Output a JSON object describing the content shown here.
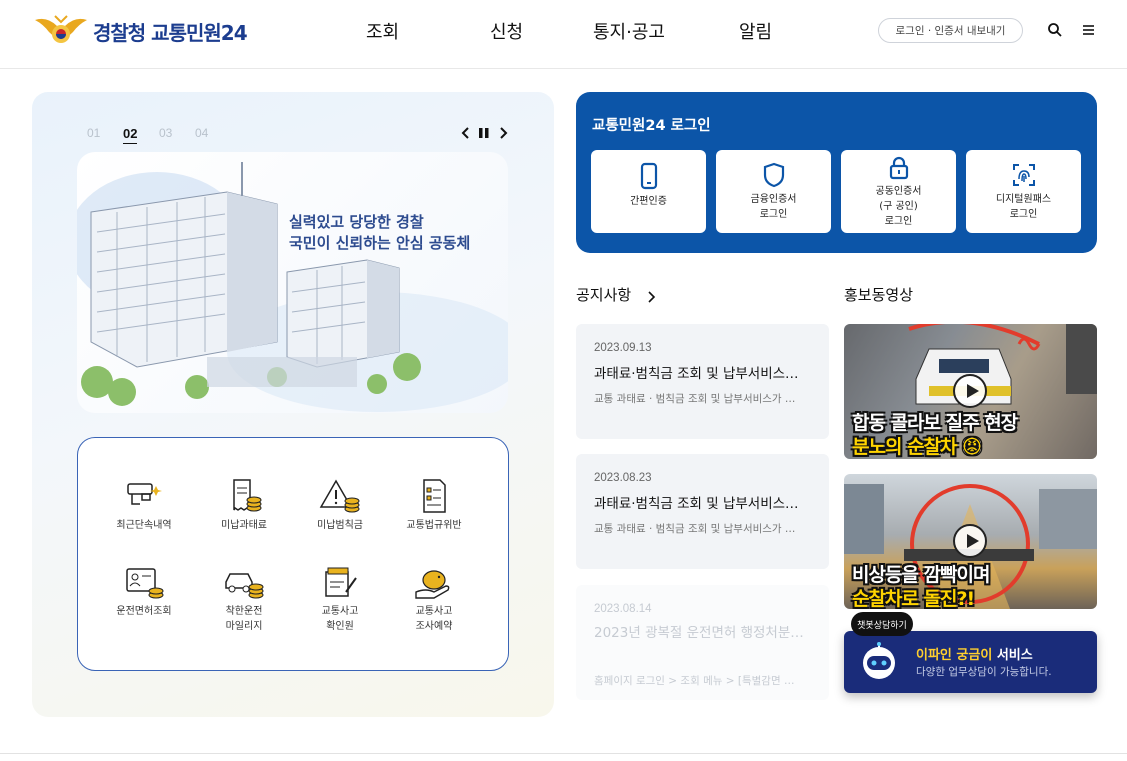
{
  "header": {
    "logo_part1": "경찰청",
    "logo_part2": "교통민원24",
    "nav": [
      "조회",
      "신청",
      "통지·공고",
      "알림"
    ],
    "cert_button": "로그인 · 인증서 내보내기"
  },
  "slider": {
    "numbers": [
      "01",
      "02",
      "03",
      "04"
    ],
    "active_index": 1,
    "banner_line1": "실력있고 당당한 경찰",
    "banner_line2": "국민이 신뢰하는 안심 공동체"
  },
  "services": [
    {
      "label": "최근단속내역",
      "icon": "camera-icon"
    },
    {
      "label": "미납과태료",
      "icon": "receipt-coins-icon"
    },
    {
      "label": "미납범칙금",
      "icon": "warning-coins-icon"
    },
    {
      "label": "교통법규위반",
      "icon": "document-check-icon"
    },
    {
      "label": "운전면허조회",
      "icon": "license-card-icon"
    },
    {
      "label_line1": "착한운전",
      "label_line2": "마일리지",
      "icon": "car-coins-icon"
    },
    {
      "label_line1": "교통사고",
      "label_line2": "확인원",
      "icon": "certificate-icon"
    },
    {
      "label_line1": "교통사고",
      "label_line2": "조사예약",
      "icon": "piggy-bank-icon"
    }
  ],
  "login": {
    "title": "교통민원24 로그인",
    "cards": [
      {
        "line1": "간편인증",
        "icon": "phone-icon"
      },
      {
        "line1": "금융인증서",
        "line2": "로그인",
        "icon": "shield-icon"
      },
      {
        "line1": "공동인증서",
        "line2": "(구 공인)",
        "line3": "로그인",
        "icon": "lock-icon"
      },
      {
        "line1": "디지털원패스",
        "line2": "로그인",
        "icon": "fingerprint-icon"
      }
    ]
  },
  "notices": {
    "title": "공지사항",
    "items": [
      {
        "date": "2023.09.13",
        "title": "과태료·범칙금 조회 및 납부서비스…",
        "desc": "교통 과태료 · 범칙금 조회 및 납부서비스가 …"
      },
      {
        "date": "2023.08.23",
        "title": "과태료·범칙금 조회 및 납부서비스…",
        "desc": "교통 과태료 · 범칙금 조회 및 납부서비스가 …"
      },
      {
        "date": "2023.08.14",
        "title": "2023년 광복절 운전면허 행정처분…",
        "desc": "홈페이지 로그인 > 조회 메뉴 > [특별감면 …"
      }
    ]
  },
  "videos": {
    "title": "홍보동영상",
    "items": [
      {
        "caption1": "합동 콜라보 질주 현장",
        "caption2": "분노의 순찰차 😡"
      },
      {
        "caption1": "비상등을 깜빡이며",
        "caption2": "순찰차로 돌진?!"
      }
    ]
  },
  "chatbot": {
    "bubble": "챗봇상담하기",
    "title_hl": "이파인 궁금이",
    "title_rest": " 서비스",
    "subtitle": "다양한 업무상담이 가능합니다."
  }
}
